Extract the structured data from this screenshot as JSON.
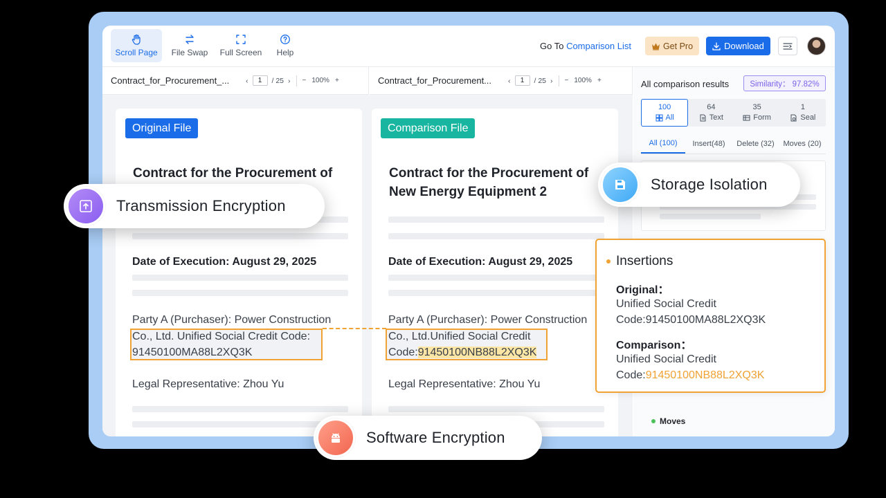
{
  "toolbar": {
    "tools": [
      {
        "label": "Scroll Page",
        "icon": "hand-icon",
        "active": true
      },
      {
        "label": "File Swap",
        "icon": "swap-icon",
        "active": false
      },
      {
        "label": "Full Screen",
        "icon": "fullscreen-icon",
        "active": false
      },
      {
        "label": "Help",
        "icon": "help-icon",
        "active": false
      }
    ],
    "goto_prefix": "Go To ",
    "goto_link": "Comparison List",
    "get_pro": "Get Pro",
    "download": "Download"
  },
  "doc_left": {
    "filename": "Contract_for_Procurement_...",
    "page": "1",
    "total": "/ 25",
    "zoom": "100%",
    "tag": "Original File",
    "title": "Contract for the Procurement of",
    "date": "Date of Execution: August 29, 2025",
    "party_line1": "Party A (Purchaser): Power Construction",
    "party_line2": "Co., Ltd. Unified Social Credit Code:",
    "party_line3": "91450100MA88L2XQ3K",
    "legal": "Legal Representative: Zhou Yu"
  },
  "doc_right": {
    "filename": "Contract_for_Procurement...",
    "page": "1",
    "total": "/ 25",
    "zoom": "100%",
    "tag": "Comparison File",
    "title_line1": "Contract for the Procurement of",
    "title_line2": "New Energy Equipment 2",
    "date": "Date of Execution: August 29, 2025",
    "party_line1": "Party A (Purchaser): Power Construction",
    "party_line2": "Co., Ltd.Unified Social Credit",
    "party_line3_prefix": "Code:",
    "party_line3_hl": "91450100NB88L2XQ3K",
    "legal": "Legal Representative: Zhou Yu"
  },
  "panel": {
    "title": "All comparison results",
    "similarity": "Similarity： 97.82%",
    "stats": [
      {
        "count": "100",
        "label": "All",
        "icon": "grid-icon",
        "active": true
      },
      {
        "count": "64",
        "label": "Text",
        "icon": "document-icon",
        "active": false
      },
      {
        "count": "35",
        "label": "Form",
        "icon": "table-icon",
        "active": false
      },
      {
        "count": "1",
        "label": "Seal",
        "icon": "seal-icon",
        "active": false
      }
    ],
    "filters": [
      {
        "label": "All (100)",
        "active": true
      },
      {
        "label": "Insert(48)",
        "active": false
      },
      {
        "label": "Delete (32)",
        "active": false
      },
      {
        "label": "Moves (20)",
        "active": false
      }
    ],
    "moves_label": "Moves"
  },
  "popover": {
    "heading": "Insertions",
    "original_label": "Original：",
    "original_line1": "Unified Social Credit",
    "original_line2": "Code:91450100MA88L2XQ3K",
    "comparison_label": "Comparison：",
    "comparison_line1": "Unified Social Credit",
    "comparison_prefix": "Code:",
    "comparison_hl": "91450100NB88L2XQ3K"
  },
  "badges": {
    "transmission": "Transmission Encryption",
    "storage": "Storage Isolation",
    "software": "Software Encryption"
  },
  "colors": {
    "accent": "#1a6ce8",
    "highlight": "#f0a233",
    "original_tag": "#1a6ce8",
    "comparison_tag": "#18b5a0"
  }
}
